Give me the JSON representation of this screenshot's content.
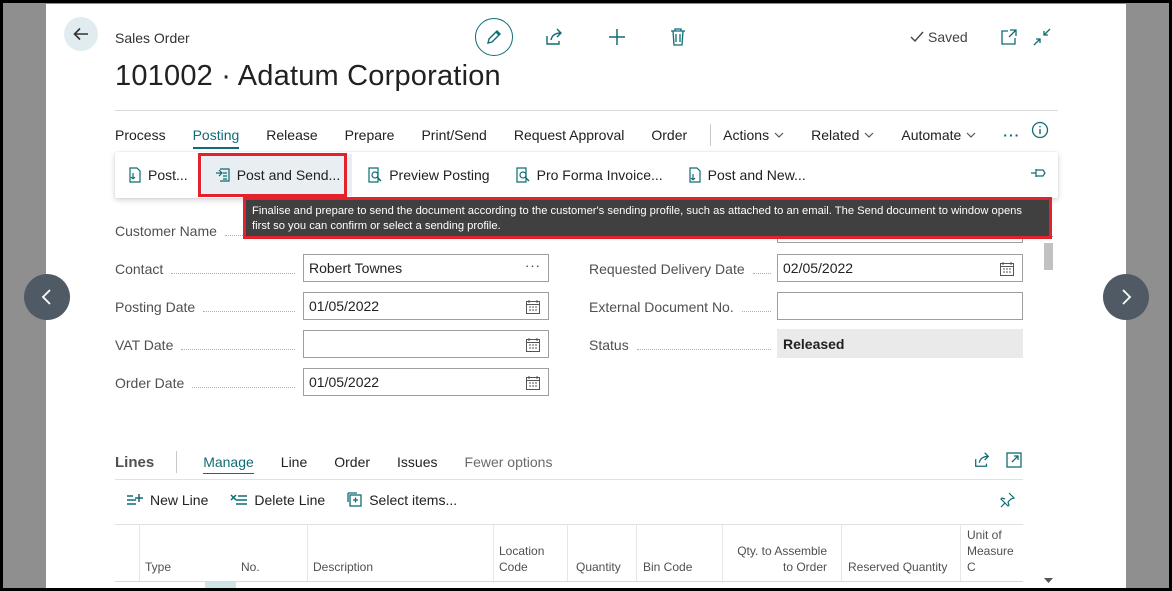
{
  "header": {
    "page_type": "Sales Order",
    "title": "101002 · Adatum Corporation",
    "saved_label": "Saved"
  },
  "menu": {
    "items": [
      "Process",
      "Posting",
      "Release",
      "Prepare",
      "Print/Send",
      "Request Approval",
      "Order"
    ],
    "active": "Posting",
    "dropdowns": [
      "Actions",
      "Related",
      "Automate"
    ],
    "more": "···"
  },
  "ribbon": {
    "post": "Post...",
    "post_and_send": "Post and Send...",
    "preview_posting": "Preview Posting",
    "pro_forma": "Pro Forma Invoice...",
    "post_and_new": "Post and New..."
  },
  "tooltip": {
    "text": "Finalise and prepare to send the document according to the customer's sending profile, such as attached to an email. The Send document to window opens first so you can confirm or select a sending profile."
  },
  "general": {
    "customer_name_label": "Customer Name",
    "contact_label": "Contact",
    "contact_value": "Robert Townes",
    "posting_date_label": "Posting Date",
    "posting_date_value": "01/05/2022",
    "vat_date_label": "VAT Date",
    "vat_date_value": "",
    "order_date_label": "Order Date",
    "order_date_value": "01/05/2022",
    "requested_delivery_label": "Requested Delivery Date",
    "requested_delivery_value": "02/05/2022",
    "external_doc_label": "External Document No.",
    "external_doc_value": "",
    "status_label": "Status",
    "status_value": "Released"
  },
  "lines": {
    "title": "Lines",
    "tabs": [
      "Manage",
      "Line",
      "Order",
      "Issues",
      "Fewer options"
    ],
    "actions": {
      "new_line": "New Line",
      "delete_line": "Delete Line",
      "select_items": "Select items..."
    },
    "columns": [
      "Type",
      "No.",
      "Description",
      "Location Code",
      "Quantity",
      "Bin Code",
      "Qty. to Assemble to Order",
      "Reserved Quantity",
      "Unit of Measure C"
    ]
  },
  "colors": {
    "accent": "#0f6c74",
    "highlight_border": "#e3222d",
    "tooltip_bg": "#404040",
    "backdrop": "#8f8f8f"
  }
}
